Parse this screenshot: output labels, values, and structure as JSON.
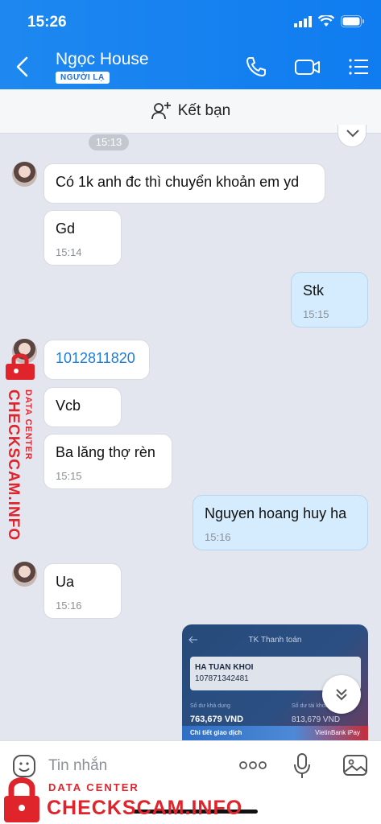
{
  "status": {
    "time": "15:26"
  },
  "header": {
    "name": "Ngọc House",
    "badge": "NGƯỜI LẠ"
  },
  "add_friend": {
    "label": "Kết bạn"
  },
  "messages": [
    {
      "time_pill": "15:13"
    },
    {
      "text": "Có 1k anh đc thì chuyển khoản em yd"
    },
    {
      "text": "Gd",
      "time": "15:14"
    },
    {
      "text": "Stk",
      "time": "15:15"
    },
    {
      "text": "1012811820"
    },
    {
      "text": "Vcb"
    },
    {
      "text": "Ba lăng thợ rèn",
      "time": "15:15"
    },
    {
      "text": "Nguyen hoang huy ha",
      "time": "15:16"
    },
    {
      "text": "Ua",
      "time": "15:16"
    }
  ],
  "image_card": {
    "title": "TK Thanh toán",
    "name": "HA TUAN KHOI",
    "number": "107871342481",
    "lbl1": "Số dư khả dụng",
    "lbl2": "Số dư tài khoản",
    "val1": "763,679 VND",
    "val2": "813,679 VND",
    "bar_left": "Chi tiết giao dịch",
    "bar_right": "VietinBank iPay"
  },
  "input": {
    "placeholder": "Tin nhắn"
  },
  "watermark": {
    "line1": "DATA CENTER",
    "line2": "CHECKSCAM.INFO"
  },
  "colors": {
    "header": "#1e88f0",
    "my_bubble": "#d4ecfd",
    "watermark": "#e0242c"
  }
}
